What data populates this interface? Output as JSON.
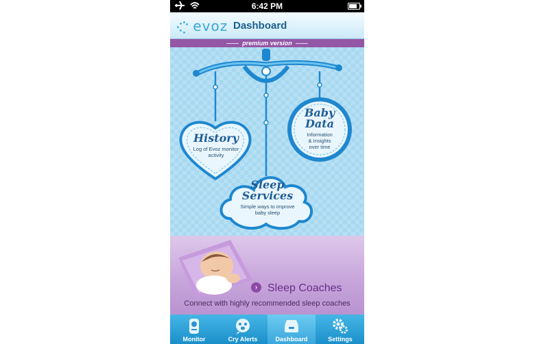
{
  "status_bar": {
    "time": "6:42 PM",
    "icons": [
      "airplane-icon",
      "wifi-icon",
      "battery-icon"
    ]
  },
  "header": {
    "logo": "evoz",
    "title": "Dashboard"
  },
  "banner": {
    "label": "premium version"
  },
  "cards": {
    "history": {
      "title": "History",
      "subtitle_line1": "Log of Evoz monitor",
      "subtitle_line2": "activity"
    },
    "baby_data": {
      "title_line1": "Baby",
      "title_line2": "Data",
      "subtitle_line1": "Information",
      "subtitle_line2": "& Insights",
      "subtitle_line3": "over time"
    },
    "sleep_services": {
      "title_line1": "Sleep",
      "title_line2": "Services",
      "subtitle_line1": "Simple ways to improve",
      "subtitle_line2": "baby sleep"
    }
  },
  "promo": {
    "title": "Sleep Coaches",
    "subtitle": "Connect with highly recommended sleep coaches"
  },
  "tabs": [
    {
      "label": "Monitor",
      "icon": "monitor-icon"
    },
    {
      "label": "Cry Alerts",
      "icon": "cry-alerts-icon"
    },
    {
      "label": "Dashboard",
      "icon": "dashboard-icon",
      "active": true
    },
    {
      "label": "Settings",
      "icon": "settings-gear-icon"
    }
  ],
  "colors": {
    "sky": "#a9dbf2",
    "accent_blue": "#2e8fd0",
    "purple": "#9357a6",
    "tab_bar": "#1b8fca"
  }
}
